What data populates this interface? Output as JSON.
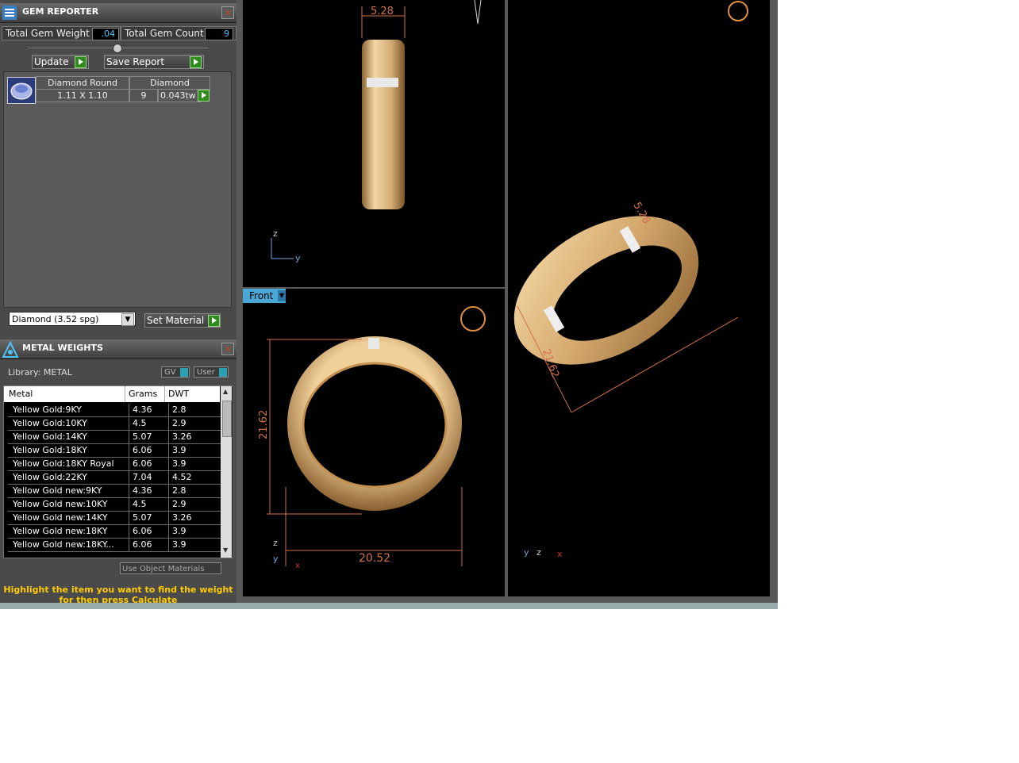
{
  "gem_reporter": {
    "title": "GEM REPORTER",
    "close": "x",
    "total_weight_label": "Total Gem Weight",
    "total_weight_value": ".04",
    "total_count_label": "Total Gem Count",
    "total_count_value": "9",
    "update_label": "Update",
    "save_report_label": "Save Report",
    "gem_row": {
      "shape": "Diamond Round",
      "material": "Diamond",
      "size": "1.11 X 1.10",
      "count": "9",
      "weight": "0.043tw"
    },
    "material_select": "Diamond    (3.52 spg)",
    "set_material_label": "Set Material"
  },
  "metal_weights": {
    "title": "METAL WEIGHTS",
    "close": "x",
    "library": "Library: METAL",
    "gv_label": "GV",
    "user_label": "User",
    "columns": [
      "Metal",
      "Grams",
      "DWT"
    ],
    "rows": [
      [
        "Yellow Gold:9KY",
        "4.36",
        "2.8"
      ],
      [
        "Yellow Gold:10KY",
        "4.5",
        "2.9"
      ],
      [
        "Yellow Gold:14KY",
        "5.07",
        "3.26"
      ],
      [
        "Yellow Gold:18KY",
        "6.06",
        "3.9"
      ],
      [
        "Yellow Gold:18KY Royal",
        "6.06",
        "3.9"
      ],
      [
        "Yellow Gold:22KY",
        "7.04",
        "4.52"
      ],
      [
        "Yellow Gold new:9KY",
        "4.36",
        "2.8"
      ],
      [
        "Yellow Gold new:10KY",
        "4.5",
        "2.9"
      ],
      [
        "Yellow Gold new:14KY",
        "5.07",
        "3.26"
      ],
      [
        "Yellow Gold new:18KY",
        "6.06",
        "3.9"
      ],
      [
        "Yellow Gold new:18KY...",
        "6.06",
        "3.9"
      ]
    ],
    "use_object_materials": "Use Object Materials",
    "hint_line1": "Highlight the item you want to find the weight",
    "hint_line2": "for then press Calculate"
  },
  "viewports": {
    "front_label": "Front",
    "dim_top_width": "5.28",
    "dim_height": "21.62",
    "dim_width": "20.52",
    "dim_persp_top": "5.28",
    "dim_persp_side": "21.62",
    "axis_z": "z",
    "axis_y": "y",
    "axis_x": "x"
  },
  "colors": {
    "panel_bg": "#4a4a4a",
    "accent_blue": "#4fc3f7",
    "gold": "#c8a060",
    "dimension": "#d0704a",
    "hint_yellow": "#ffcc00"
  }
}
